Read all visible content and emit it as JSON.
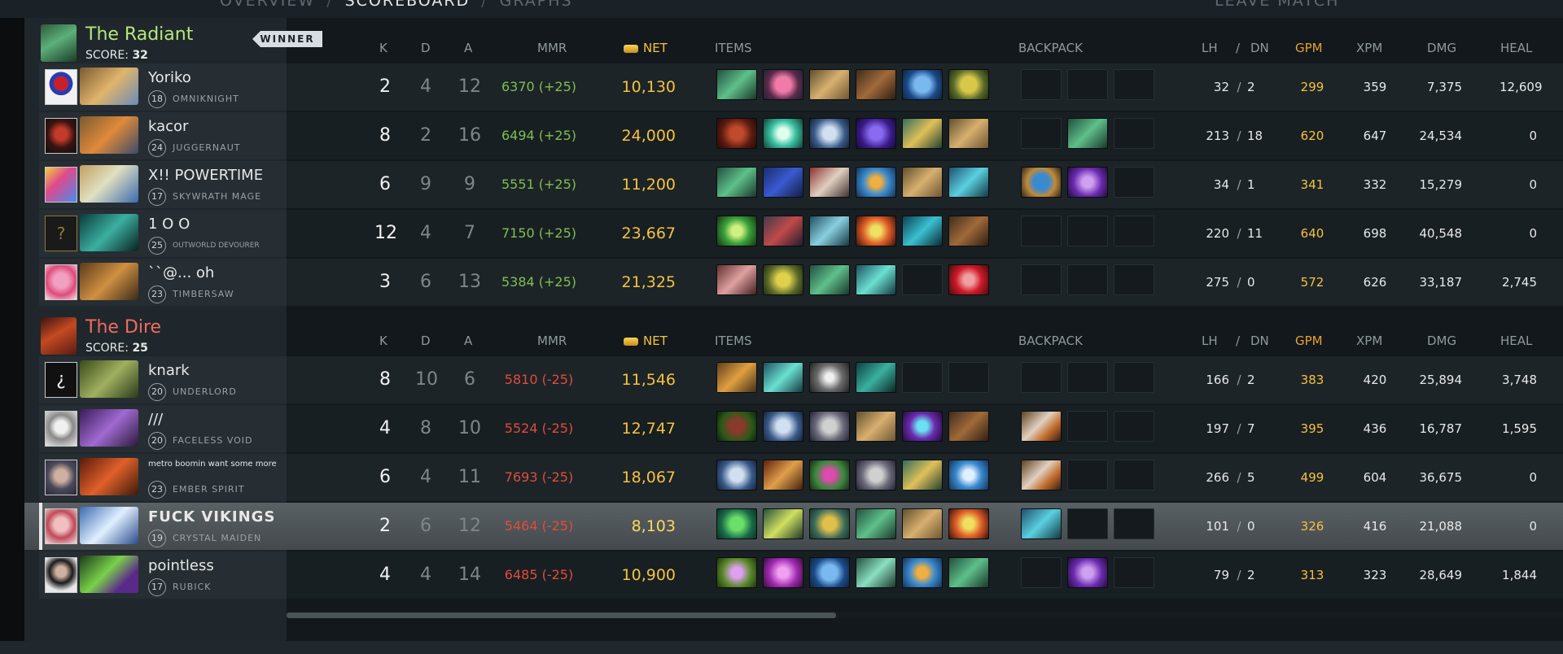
{
  "nav": {
    "tabs": [
      "OVERVIEW",
      "SCOREBOARD",
      "GRAPHS"
    ],
    "active_tab": "SCOREBOARD",
    "leave": "LEAVE MATCH"
  },
  "headers": {
    "k": "K",
    "d": "D",
    "a": "A",
    "mmr": "MMR",
    "net": "NET",
    "items": "ITEMS",
    "backpack": "BACKPACK",
    "lh": "LH",
    "slash": "/",
    "dn": "DN",
    "gpm": "GPM",
    "xpm": "XPM",
    "dmg": "DMG",
    "heal": "HEAL"
  },
  "radiant": {
    "name": "The Radiant",
    "score_label": "SCORE:",
    "score": "32",
    "badge": "WINNER",
    "players": [
      {
        "name": "Yoriko",
        "level": "18",
        "hero": "OMNIKNIGHT",
        "k": "2",
        "d": "4",
        "a": "12",
        "mmr": "6370 (+25)",
        "net": "10,130",
        "lh": "32",
        "dn": "2",
        "gpm": "299",
        "xpm": "359",
        "dmg": "7,375",
        "heal": "12,609"
      },
      {
        "name": "kacor",
        "level": "24",
        "hero": "JUGGERNAUT",
        "k": "8",
        "d": "2",
        "a": "16",
        "mmr": "6494 (+25)",
        "net": "24,000",
        "lh": "213",
        "dn": "18",
        "gpm": "620",
        "xpm": "647",
        "dmg": "24,534",
        "heal": "0"
      },
      {
        "name": "X!! POWERTIME",
        "level": "17",
        "hero": "SKYWRATH MAGE",
        "k": "6",
        "d": "9",
        "a": "9",
        "mmr": "5551 (+25)",
        "net": "11,200",
        "lh": "34",
        "dn": "1",
        "gpm": "341",
        "xpm": "332",
        "dmg": "15,279",
        "heal": "0"
      },
      {
        "name": "1 O O",
        "level": "25",
        "hero": "OUTWORLD DEVOURER",
        "k": "12",
        "d": "4",
        "a": "7",
        "mmr": "7150 (+25)",
        "net": "23,667",
        "lh": "220",
        "dn": "11",
        "gpm": "640",
        "xpm": "698",
        "dmg": "40,548",
        "heal": "0"
      },
      {
        "name": "``@... oh",
        "level": "23",
        "hero": "TIMBERSAW",
        "k": "3",
        "d": "6",
        "a": "13",
        "mmr": "5384 (+25)",
        "net": "21,325",
        "lh": "275",
        "dn": "0",
        "gpm": "572",
        "xpm": "626",
        "dmg": "33,187",
        "heal": "2,745"
      }
    ]
  },
  "dire": {
    "name": "The Dire",
    "score_label": "SCORE:",
    "score": "25",
    "players": [
      {
        "name": "knark",
        "level": "20",
        "hero": "UNDERLORD",
        "k": "8",
        "d": "10",
        "a": "6",
        "mmr": "5810 (-25)",
        "net": "11,546",
        "lh": "166",
        "dn": "2",
        "gpm": "383",
        "xpm": "420",
        "dmg": "25,894",
        "heal": "3,748"
      },
      {
        "name": "///",
        "level": "20",
        "hero": "FACELESS VOID",
        "k": "4",
        "d": "8",
        "a": "10",
        "mmr": "5524 (-25)",
        "net": "12,747",
        "lh": "197",
        "dn": "7",
        "gpm": "395",
        "xpm": "436",
        "dmg": "16,787",
        "heal": "1,595"
      },
      {
        "name": "metro boomin want some more",
        "level": "23",
        "hero": "EMBER SPIRIT",
        "k": "6",
        "d": "4",
        "a": "11",
        "mmr": "7693 (-25)",
        "net": "18,067",
        "lh": "266",
        "dn": "5",
        "gpm": "499",
        "xpm": "604",
        "dmg": "36,675",
        "heal": "0"
      },
      {
        "name": "FUCK VIKINGS",
        "level": "19",
        "hero": "CRYSTAL MAIDEN",
        "k": "2",
        "d": "6",
        "a": "12",
        "mmr": "5464 (-25)",
        "net": "8,103",
        "lh": "101",
        "dn": "0",
        "gpm": "326",
        "xpm": "416",
        "dmg": "21,088",
        "heal": "0"
      },
      {
        "name": "pointless",
        "level": "17",
        "hero": "RUBICK",
        "k": "4",
        "d": "4",
        "a": "14",
        "mmr": "6485 (-25)",
        "net": "10,900",
        "lh": "79",
        "dn": "2",
        "gpm": "313",
        "xpm": "323",
        "dmg": "28,649",
        "heal": "1,844"
      }
    ]
  }
}
